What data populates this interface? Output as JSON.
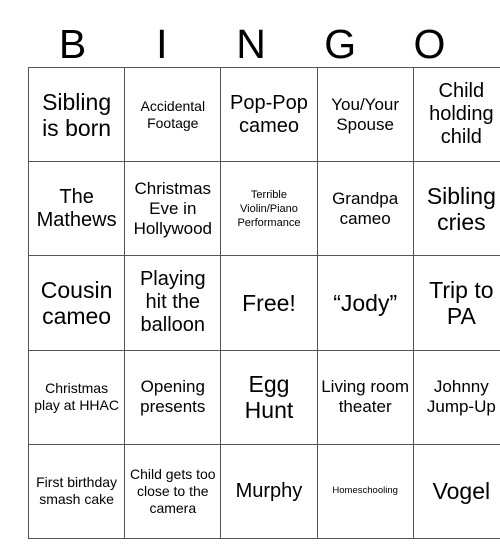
{
  "card": {
    "title": "BINGO",
    "header_letters": [
      "B",
      "I",
      "N",
      "G",
      "O"
    ],
    "grid_size": "5x5",
    "free_space_label": "Free!",
    "colors": {
      "background": "#ffffff",
      "text": "#000000",
      "grid_line": "#555555"
    },
    "rows": [
      [
        {
          "text": "Sibling is born",
          "size": "fs-xl"
        },
        {
          "text": "Accidental Footage",
          "size": "fs-sm"
        },
        {
          "text": "Pop-Pop cameo",
          "size": "fs-lg"
        },
        {
          "text": "You/Your Spouse",
          "size": "fs-md"
        },
        {
          "text": "Child holding child",
          "size": "fs-lg"
        }
      ],
      [
        {
          "text": "The Mathews",
          "size": "fs-lg"
        },
        {
          "text": "Christmas Eve in Hollywood",
          "size": "fs-md"
        },
        {
          "text": "Terrible Violin/Piano Performance",
          "size": "fs-xs"
        },
        {
          "text": "Grandpa cameo",
          "size": "fs-md"
        },
        {
          "text": "Sibling cries",
          "size": "fs-xl"
        }
      ],
      [
        {
          "text": "Cousin cameo",
          "size": "fs-xl"
        },
        {
          "text": "Playing hit the balloon",
          "size": "fs-lg"
        },
        {
          "text": "Free!",
          "size": "fs-xl"
        },
        {
          "text": "“Jody”",
          "size": "fs-xl"
        },
        {
          "text": "Trip to PA",
          "size": "fs-xl"
        }
      ],
      [
        {
          "text": "Christmas play at HHAC",
          "size": "fs-sm"
        },
        {
          "text": "Opening presents",
          "size": "fs-md"
        },
        {
          "text": "Egg Hunt",
          "size": "fs-xl"
        },
        {
          "text": "Living room theater",
          "size": "fs-md"
        },
        {
          "text": "Johnny Jump-Up",
          "size": "fs-md"
        }
      ],
      [
        {
          "text": "First birthday smash cake",
          "size": "fs-sm"
        },
        {
          "text": "Child gets too close to the camera",
          "size": "fs-sm"
        },
        {
          "text": "Murphy",
          "size": "fs-lg"
        },
        {
          "text": "Homeschooling",
          "size": "fs-xxs"
        },
        {
          "text": "Vogel",
          "size": "fs-xl"
        }
      ]
    ]
  }
}
